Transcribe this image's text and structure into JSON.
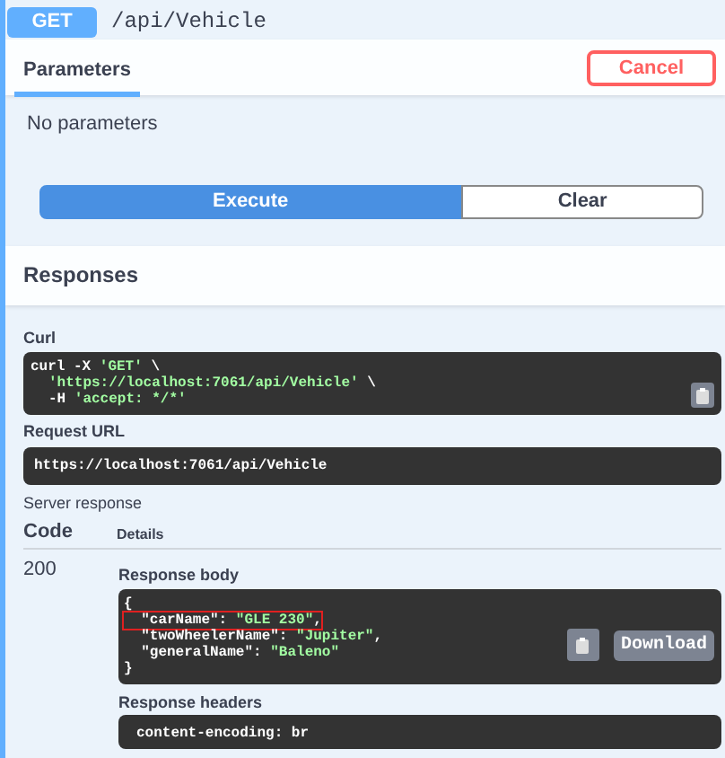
{
  "operation": {
    "method": "GET",
    "path": "/api/Vehicle"
  },
  "parameters": {
    "tab": "Parameters",
    "cancel": "Cancel",
    "empty": "No parameters",
    "execute": "Execute",
    "clear": "Clear"
  },
  "responses": {
    "title": "Responses",
    "curl": {
      "label": "Curl",
      "lines": [
        {
          "indented": false,
          "parts": [
            {
              "kind": "plain",
              "text": "curl -X "
            },
            {
              "kind": "string",
              "text": "'GET'"
            },
            {
              "kind": "plain",
              "text": " \\"
            }
          ]
        },
        {
          "indented": true,
          "parts": [
            {
              "kind": "string",
              "text": "'https://localhost:7061/api/Vehicle'"
            },
            {
              "kind": "plain",
              "text": " \\"
            }
          ]
        },
        {
          "indented": true,
          "parts": [
            {
              "kind": "plain",
              "text": "-H "
            },
            {
              "kind": "string",
              "text": "'accept: */*'"
            }
          ]
        }
      ]
    },
    "request_url": {
      "label": "Request URL",
      "url": "https://localhost:7061/api/Vehicle"
    },
    "server_response": "Server response",
    "columns": [
      "Code",
      "Details"
    ],
    "code": "200",
    "body": {
      "label": "Response body",
      "download": "Download",
      "lines": [
        {
          "highlighted": false,
          "parts": [
            {
              "kind": "plain",
              "text": "{"
            }
          ]
        },
        {
          "highlighted": true,
          "parts": [
            {
              "kind": "plain",
              "text": "  \"carName\": "
            },
            {
              "kind": "string",
              "text": "\"GLE 230\""
            },
            {
              "kind": "plain",
              "text": ","
            }
          ]
        },
        {
          "highlighted": false,
          "parts": [
            {
              "kind": "plain",
              "text": "  \"twoWheelerName\": "
            },
            {
              "kind": "string",
              "text": "\"Jupiter\""
            },
            {
              "kind": "plain",
              "text": ","
            }
          ]
        },
        {
          "highlighted": false,
          "parts": [
            {
              "kind": "plain",
              "text": "  \"generalName\": "
            },
            {
              "kind": "string",
              "text": "\"Baleno\""
            }
          ]
        },
        {
          "highlighted": false,
          "parts": [
            {
              "kind": "plain",
              "text": "}"
            }
          ]
        }
      ]
    },
    "headers": {
      "label": "Response headers",
      "lines": [
        "content-encoding: br"
      ]
    }
  }
}
